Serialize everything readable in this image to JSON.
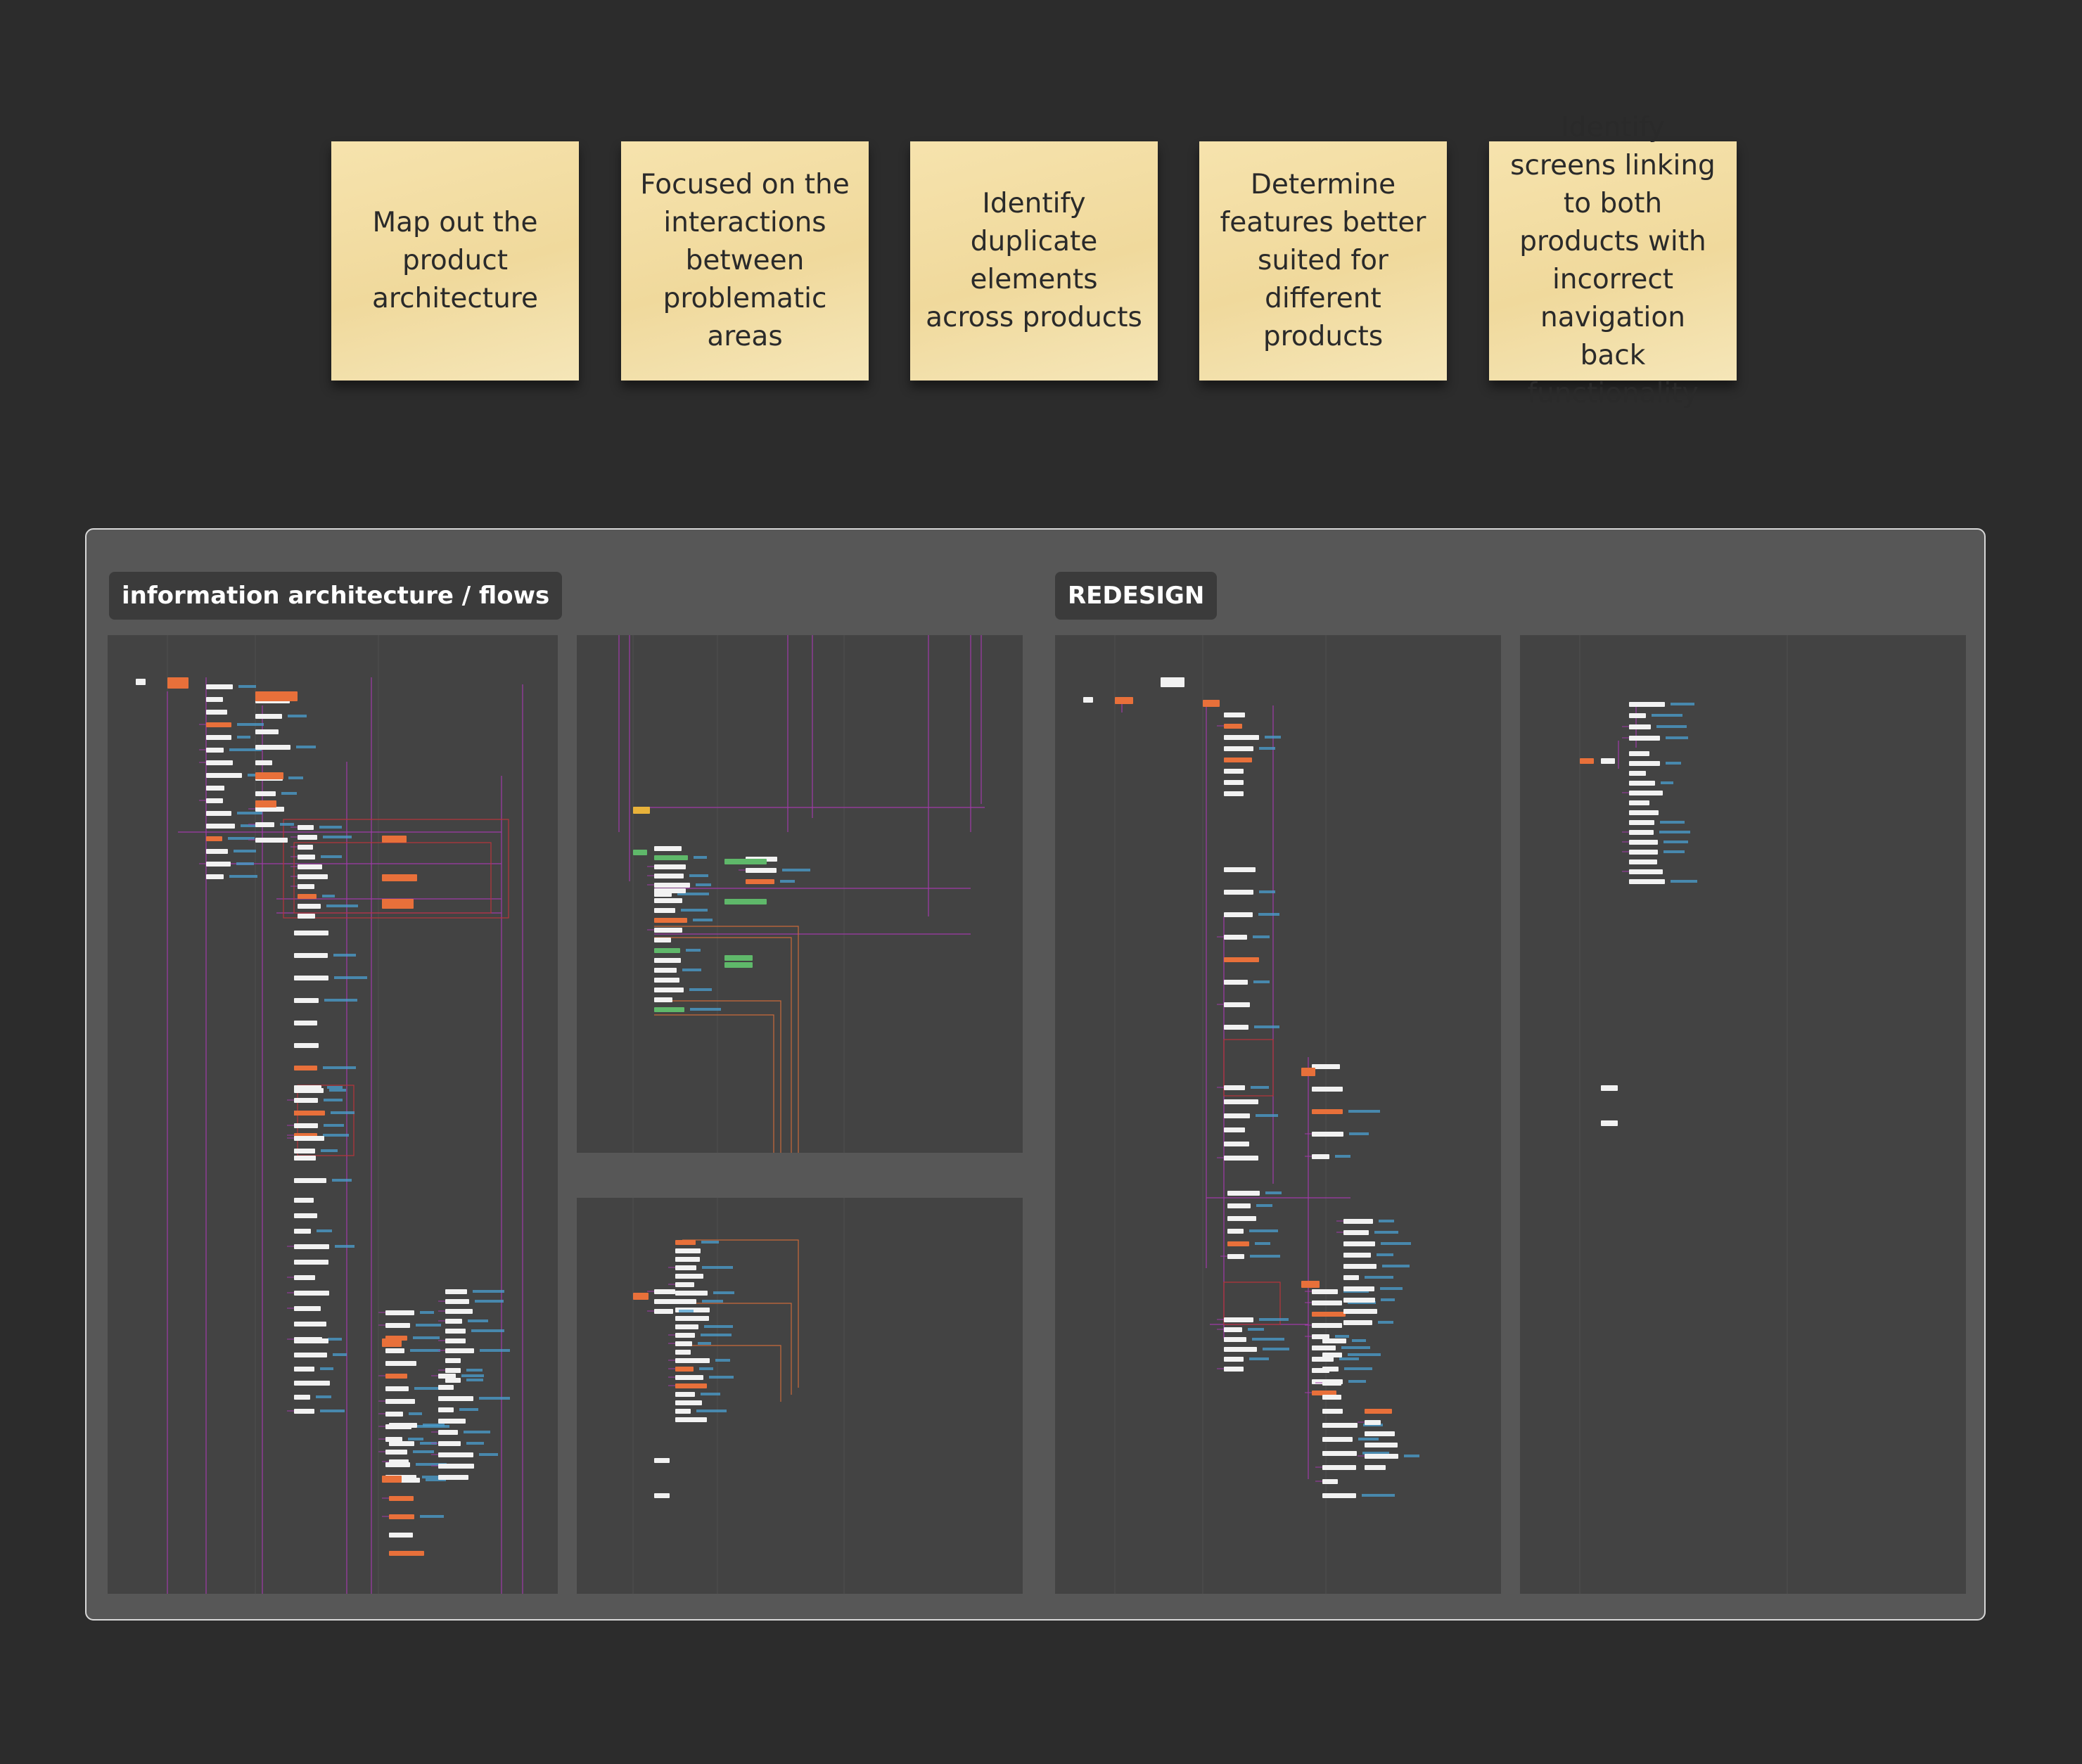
{
  "stickies": [
    {
      "text": "Map out the product architecture"
    },
    {
      "text": "Focused on the interactions between problematic areas"
    },
    {
      "text": "Identify duplicate elements across products"
    },
    {
      "text": "Determine features better suited for different products"
    },
    {
      "text": "Identify screens linking to both products with incorrect navigation back functionality"
    }
  ],
  "board": {
    "section_labels": {
      "information_architecture": "information architecture / flows",
      "redesign": "REDESIGN"
    }
  },
  "colors": {
    "canvas": "#2c2c2c",
    "board": "#575757",
    "frame": "#434343",
    "sticky": "#f3dfa6",
    "node_orange": "#e8703a",
    "node_green": "#5fb86a",
    "node_yellow": "#e8b23a",
    "link_magenta": "#a03aa8",
    "text_blue": "#4a9fd0",
    "link_red": "#b8343c"
  }
}
